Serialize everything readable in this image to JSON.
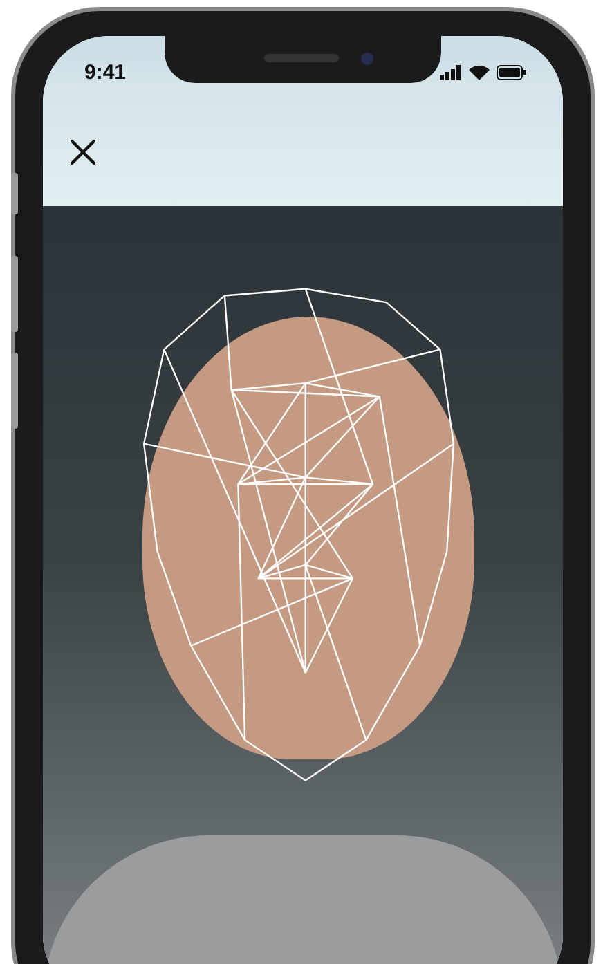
{
  "status_bar": {
    "time": "9:41"
  },
  "camera_view": {
    "face_mesh": true
  }
}
